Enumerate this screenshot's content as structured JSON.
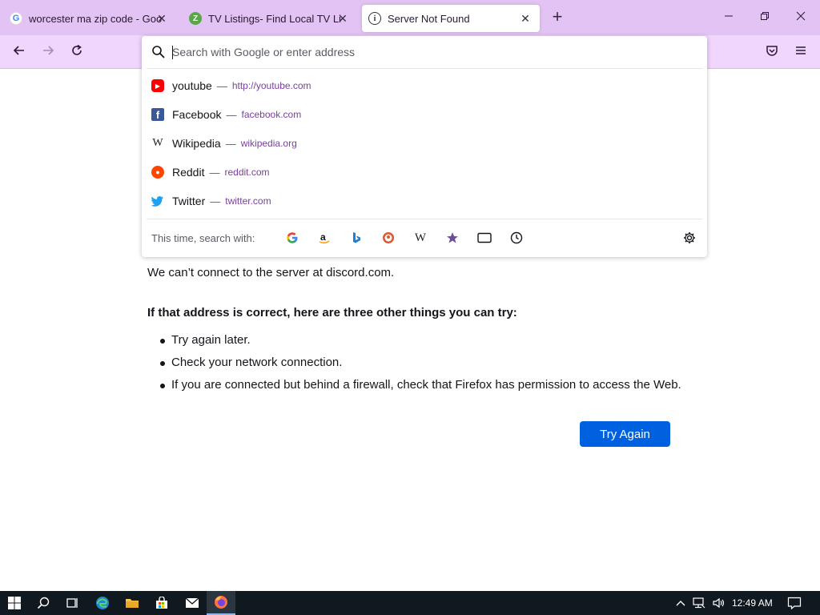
{
  "tabs": [
    {
      "title": "worcester ma zip code - Google Search",
      "icon": "google-favicon",
      "active": false
    },
    {
      "title": "TV Listings- Find Local TV Listings",
      "icon": "zap2it-favicon",
      "active": false
    },
    {
      "title": "Server Not Found",
      "icon": "info-icon",
      "active": true
    }
  ],
  "urlbar": {
    "placeholder": "Search with Google or enter address",
    "value": ""
  },
  "suggestions": [
    {
      "label": "youtube",
      "url": "http://youtube.com",
      "icon": "youtube-icon"
    },
    {
      "label": "Facebook",
      "url": "facebook.com",
      "icon": "facebook-icon"
    },
    {
      "label": "Wikipedia",
      "url": "wikipedia.org",
      "icon": "wikipedia-icon"
    },
    {
      "label": "Reddit",
      "url": "reddit.com",
      "icon": "reddit-icon"
    },
    {
      "label": "Twitter",
      "url": "twitter.com",
      "icon": "twitter-icon"
    }
  ],
  "separator": "—",
  "oneoff": {
    "label": "This time, search with:",
    "engines": [
      "google-icon",
      "amazon-icon",
      "bing-icon",
      "duckduckgo-icon",
      "wikipedia-icon",
      "bookmarks-icon",
      "tabs-icon",
      "history-icon"
    ]
  },
  "error": {
    "lead": "We can’t connect to the server at discord.com.",
    "subhead": "If that address is correct, here are three other things you can try:",
    "tips": [
      "Try again later.",
      "Check your network connection.",
      "If you are connected but behind a firewall, check that Firefox has permission to access the Web."
    ],
    "button": "Try Again"
  },
  "taskbar": {
    "clock": "12:49 AM"
  },
  "colors": {
    "tabstrip": "#e2c3f3",
    "navbar": "#f0d5fc",
    "accent": "#0061e0",
    "taskbar": "#101820"
  }
}
